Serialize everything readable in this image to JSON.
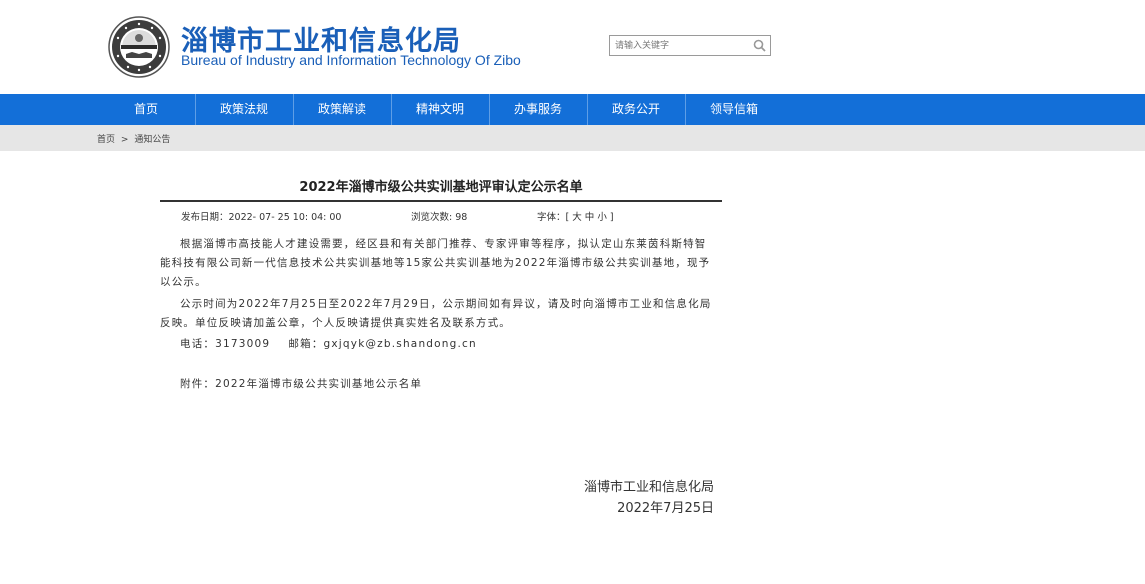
{
  "header": {
    "title_cn": "淄博市工业和信息化局",
    "title_en": "Bureau of Industry and Information Technology Of Zibo",
    "logo_icon": "emblem-icon",
    "search": {
      "placeholder": "请输入关键字",
      "icon": "search-icon"
    }
  },
  "nav": {
    "items": [
      "首页",
      "政策法规",
      "政策解读",
      "精神文明",
      "办事服务",
      "政务公开",
      "领导信箱"
    ],
    "color": "#136fd8"
  },
  "breadcrumb": {
    "home": "首页",
    "sep": ">",
    "current": "通知公告"
  },
  "article": {
    "title": "2022年淄博市级公共实训基地评审认定公示名单",
    "publish_date": "发布日期：2022- 07- 25 10: 04: 00",
    "views": "浏览次数: 98",
    "font_label": "字体：[",
    "font_large": "大",
    "font_medium": "中",
    "font_small": "小",
    "font_end": "]",
    "p1": "根据淄博市高技能人才建设需要，经区县和有关部门推荐、专家评审等程序，拟认定山东莱茵科斯特智能科技有限公司新一代信息技术公共实训基地等15家公共实训基地为2022年淄博市级公共实训基地，现予以公示。",
    "p2": "公示时间为2022年7月25日至2022年7月29日，公示期间如有异议，请及时向淄博市工业和信息化局反映。单位反映请加盖公章，个人反映请提供真实姓名及联系方式。",
    "p3": "电话：3173009    邮箱：gxjqyk@zb.shandong.cn",
    "p4": "附件：2022年淄博市级公共实训基地公示名单",
    "sign_org": "淄博市工业和信息化局",
    "sign_date": "2022年7月25日"
  }
}
